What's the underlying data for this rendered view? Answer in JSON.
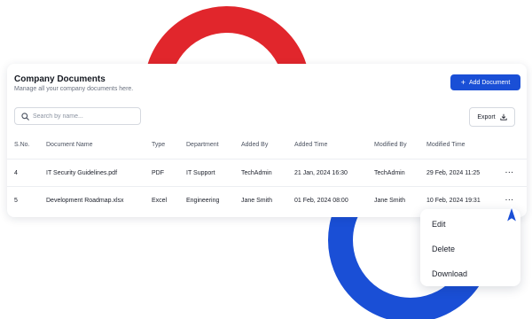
{
  "header": {
    "title": "Company Documents",
    "subtitle": "Manage all your company documents here.",
    "add_label": "Add Document"
  },
  "toolbar": {
    "search_placeholder": "Search by name...",
    "export_label": "Export"
  },
  "table": {
    "columns": [
      "S.No.",
      "Document Name",
      "Type",
      "Department",
      "Added By",
      "Added Time",
      "Modified By",
      "Modified Time"
    ],
    "rows": [
      {
        "sno": "4",
        "name": "IT Security Guidelines.pdf",
        "type": "PDF",
        "department": "IT Support",
        "added_by": "TechAdmin",
        "added_time": "21 Jan, 2024 16:30",
        "modified_by": "TechAdmin",
        "modified_time": "29 Feb, 2024 11:25",
        "more": "···"
      },
      {
        "sno": "5",
        "name": "Development Roadmap.xlsx",
        "type": "Excel",
        "department": "Engineering",
        "added_by": "Jane Smith",
        "added_time": "01 Feb, 2024 08:00",
        "modified_by": "Jane Smith",
        "modified_time": "10 Feb, 2024 19:31",
        "more": "···"
      }
    ]
  },
  "menu": {
    "items": [
      "Edit",
      "Delete",
      "Download"
    ]
  },
  "colors": {
    "accent": "#1a4fd6",
    "ring_red": "#e1262c",
    "ring_blue": "#1a4fd6"
  },
  "icons": {
    "search": "search-icon",
    "export": "download-icon",
    "add": "plus-icon",
    "more": "more-horizontal-icon",
    "cursor": "pointer-cursor-icon"
  }
}
